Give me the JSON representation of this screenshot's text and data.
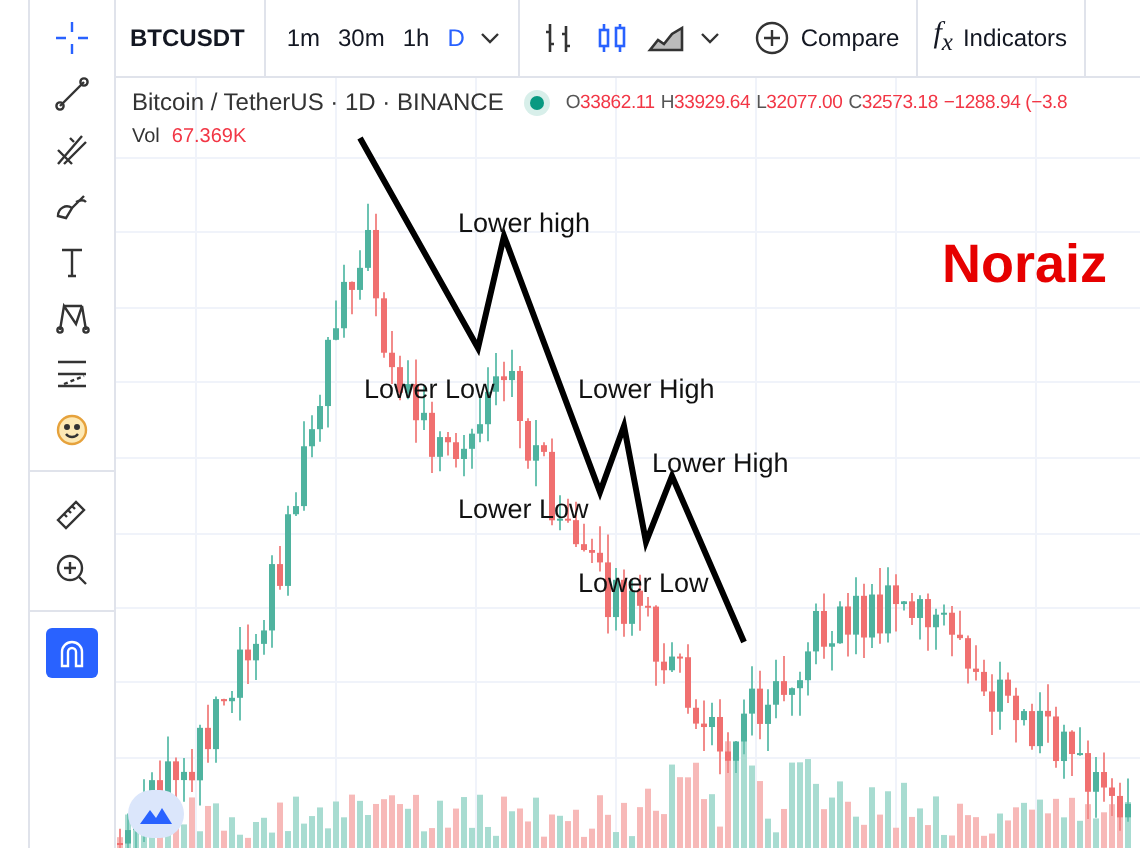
{
  "toolbar": {
    "symbol": "BTCUSDT",
    "intervals": [
      {
        "label": "1m",
        "selected": false
      },
      {
        "label": "30m",
        "selected": false
      },
      {
        "label": "1h",
        "selected": false
      },
      {
        "label": "D",
        "selected": true
      }
    ],
    "chart_types": [
      {
        "kind": "bars",
        "selected": false
      },
      {
        "kind": "candles",
        "selected": true
      },
      {
        "kind": "area",
        "selected": false
      }
    ],
    "compare": "Compare",
    "indicators": {
      "symbol": "f$_{x}$",
      "label": "Indicators"
    }
  },
  "tools": [
    {
      "kind": "crosshair",
      "selected": true
    },
    {
      "kind": "line",
      "selected": false
    },
    {
      "kind": "fork",
      "selected": false
    },
    {
      "kind": "brush",
      "selected": false
    },
    {
      "kind": "text",
      "selected": false
    },
    {
      "kind": "pattern",
      "selected": false
    },
    {
      "kind": "fib",
      "selected": false
    },
    {
      "kind": "emoji",
      "selected": false
    },
    {
      "kind": "ruler",
      "selected": false
    },
    {
      "kind": "zoom",
      "selected": false
    },
    {
      "kind": "magnet",
      "selected": true
    }
  ],
  "legend": {
    "title": "Bitcoin / TetherUS · 1D · BINANCE",
    "market_open": true,
    "ohlc": [
      {
        "label": "O",
        "value": "33862.11"
      },
      {
        "label": "H",
        "value": "33929.64"
      },
      {
        "label": "L",
        "value": "32077.00"
      },
      {
        "label": "C",
        "value": "32573.18"
      }
    ],
    "change": "−1288.94 (−3.8",
    "volume_label": "Vol",
    "volume": "67.369K"
  },
  "annotations": [
    {
      "text": "Lower high"
    },
    {
      "text": "Lower Low"
    },
    {
      "text": "Lower High"
    },
    {
      "text": "Lower High"
    },
    {
      "text": "Lower Low"
    },
    {
      "text": "Lower Low"
    }
  ],
  "author_label": "Noraiz"
}
